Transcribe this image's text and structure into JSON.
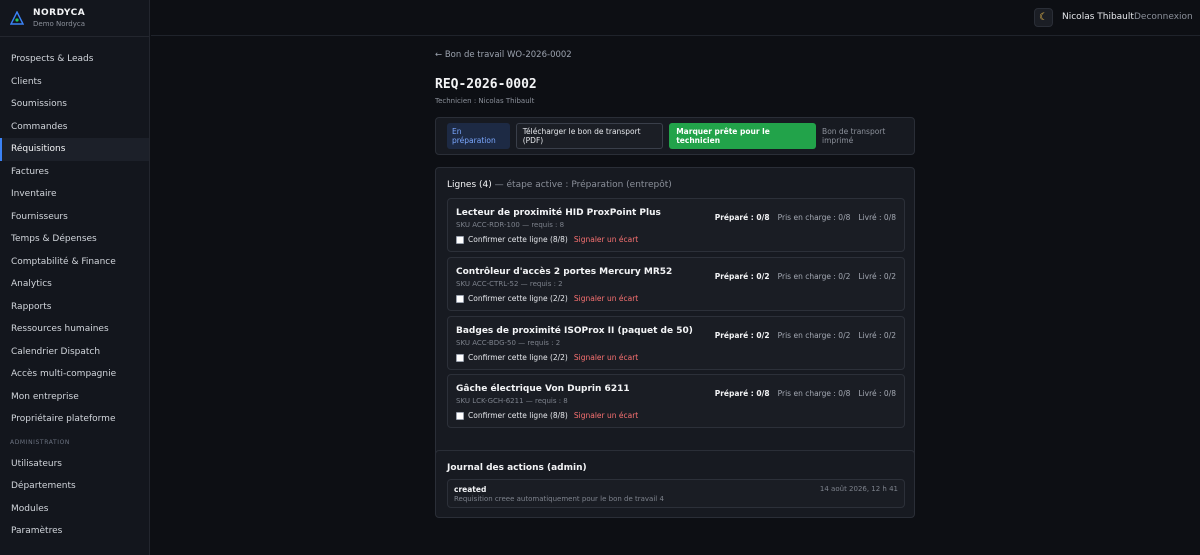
{
  "brand": {
    "name": "NORDYCA",
    "subtitle": "Demo Nordyca"
  },
  "sidebar": {
    "items": [
      {
        "label": "Prospects & Leads"
      },
      {
        "label": "Clients"
      },
      {
        "label": "Soumissions"
      },
      {
        "label": "Commandes"
      },
      {
        "label": "Réquisitions",
        "active": true
      },
      {
        "label": "Factures"
      },
      {
        "label": "Inventaire"
      },
      {
        "label": "Fournisseurs"
      },
      {
        "label": "Temps & Dépenses"
      },
      {
        "label": "Comptabilité & Finance"
      },
      {
        "label": "Analytics"
      },
      {
        "label": "Rapports"
      },
      {
        "label": "Ressources humaines"
      },
      {
        "label": "Calendrier Dispatch"
      },
      {
        "label": "Accès multi-compagnie"
      },
      {
        "label": "Mon entreprise"
      },
      {
        "label": "Propriétaire plateforme"
      }
    ],
    "admin_section": "ADMINISTRATION",
    "admin_items": [
      {
        "label": "Utilisateurs"
      },
      {
        "label": "Départements"
      },
      {
        "label": "Modules"
      },
      {
        "label": "Paramètres"
      }
    ]
  },
  "topbar": {
    "theme_icon": "moon-icon",
    "user_name": "Nicolas Thibault",
    "logout_label": "Deconnexion"
  },
  "page": {
    "back_link": "← Bon de travail WO-2026-0002",
    "title": "REQ-2026-0002",
    "technician": "Technicien : Nicolas Thibault"
  },
  "actions": {
    "status_badge": "En préparation",
    "download_label": "Télécharger le bon de transport (PDF)",
    "mark_ready_label": "Marquer prête pour le technicien",
    "printed_status": "Bon de transport imprimé"
  },
  "lines": {
    "title": "Lignes (4)",
    "active_step": "— étape active : Préparation (entrepôt)",
    "items": [
      {
        "name": "Lecteur de proximité HID ProxPoint Plus",
        "sku": "SKU ACC-RDR-100 — requis : 8",
        "confirm": "Confirmer cette ligne (8/8)",
        "report": "Signaler un écart",
        "prepared": "Préparé : 0/8",
        "taken": "Pris en charge : 0/8",
        "delivered": "Livré : 0/8"
      },
      {
        "name": "Contrôleur d'accès 2 portes Mercury MR52",
        "sku": "SKU ACC-CTRL-52 — requis : 2",
        "confirm": "Confirmer cette ligne (2/2)",
        "report": "Signaler un écart",
        "prepared": "Préparé : 0/2",
        "taken": "Pris en charge : 0/2",
        "delivered": "Livré : 0/2"
      },
      {
        "name": "Badges de proximité ISOProx II (paquet de 50)",
        "sku": "SKU ACC-BDG-50 — requis : 2",
        "confirm": "Confirmer cette ligne (2/2)",
        "report": "Signaler un écart",
        "prepared": "Préparé : 0/2",
        "taken": "Pris en charge : 0/2",
        "delivered": "Livré : 0/2"
      },
      {
        "name": "Gâche électrique Von Duprin 6211",
        "sku": "SKU LCK-GCH-6211 — requis : 8",
        "confirm": "Confirmer cette ligne (8/8)",
        "report": "Signaler un écart",
        "prepared": "Préparé : 0/8",
        "taken": "Pris en charge : 0/8",
        "delivered": "Livré : 0/8"
      }
    ]
  },
  "journal": {
    "title": "Journal des actions (admin)",
    "entries": [
      {
        "event": "created",
        "description": "Requisition creee automatiquement pour le bon de travail 4",
        "timestamp": "14 août 2026, 12 h 41"
      }
    ]
  },
  "colors": {
    "accent": "#3b82f6",
    "success": "#22a34a",
    "danger": "#f87171",
    "background": "#0d0f14"
  }
}
